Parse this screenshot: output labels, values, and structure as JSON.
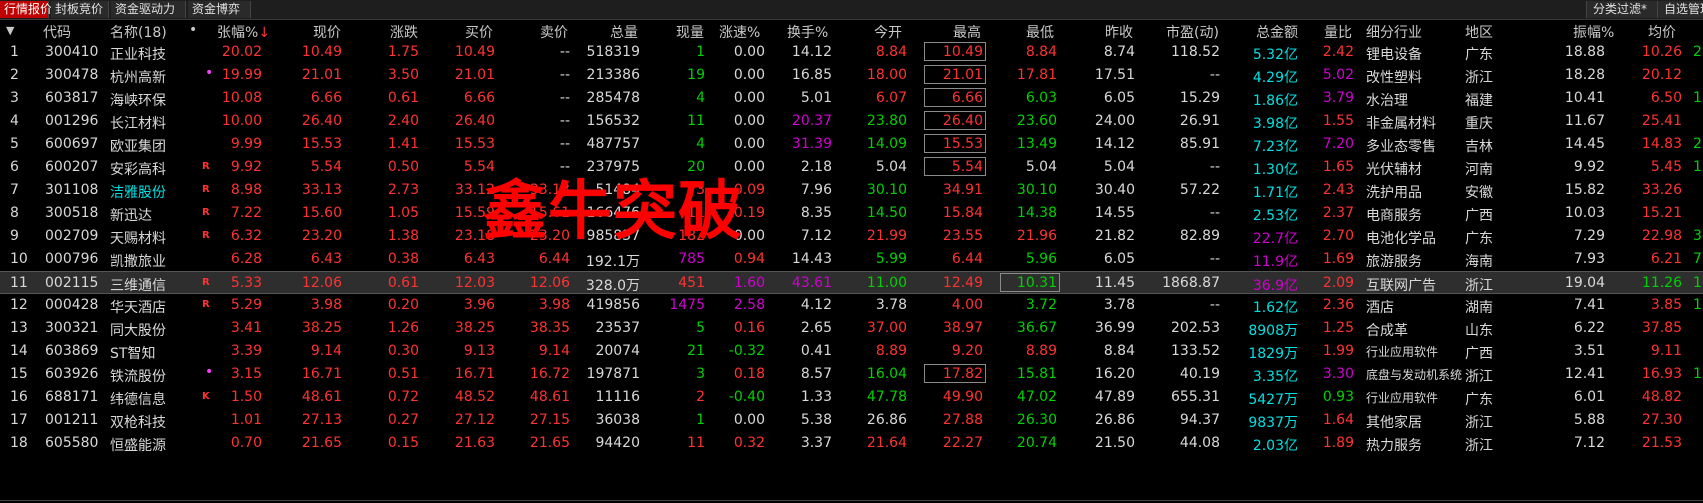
{
  "tabs": [
    "行情报价",
    "封板竞价",
    "资金驱动力",
    "资金博弈"
  ],
  "right_tabs": [
    "分类过滤*",
    "自选管理"
  ],
  "header": {
    "sort_icon": "▼",
    "code": "代码",
    "name": "名称(18)",
    "dot": "•",
    "change_pct": "张幅%",
    "sort_arrow": "↓",
    "price": "现价",
    "change": "涨跌",
    "bid": "买价",
    "ask": "卖价",
    "volume": "总量",
    "cur_vol": "现量",
    "speed": "涨速%",
    "turnover": "换手%",
    "open": "今开",
    "high": "最高",
    "low": "最低",
    "prev_close": "昨收",
    "pe": "市盈(动)",
    "amount": "总金额",
    "vol_ratio": "量比",
    "industry": "细分行业",
    "region": "地区",
    "amplitude": "振幅%",
    "avg": "均价"
  },
  "rows": [
    {
      "no": "1",
      "code": "300410",
      "name": "正业科技",
      "flag": "",
      "chg_pct": "20.02",
      "price": "10.49",
      "chg": "1.75",
      "bid": "10.49",
      "ask": "--",
      "vol": "518319",
      "cur_vol": "1",
      "speed": "0.00",
      "turnover": "14.12",
      "open": "8.84",
      "high": "10.49",
      "low": "8.84",
      "prev": "8.74",
      "pe": "118.52",
      "amount": "5.32亿",
      "vol_ratio": "2.42",
      "industry": "锂电设备",
      "region": "广东",
      "amp": "18.88",
      "avg": "10.26",
      "extra": "2"
    },
    {
      "no": "2",
      "code": "300478",
      "name": "杭州高新",
      "flag": "•",
      "chg_pct": "19.99",
      "price": "21.01",
      "chg": "3.50",
      "bid": "21.01",
      "ask": "--",
      "vol": "213386",
      "cur_vol": "19",
      "speed": "0.00",
      "turnover": "16.85",
      "open": "18.00",
      "high": "21.01",
      "low": "17.81",
      "prev": "17.51",
      "pe": "--",
      "amount": "4.29亿",
      "vol_ratio": "5.02",
      "industry": "改性塑料",
      "region": "浙江",
      "amp": "18.28",
      "avg": "20.12",
      "extra": ""
    },
    {
      "no": "3",
      "code": "603817",
      "name": "海峡环保",
      "flag": "",
      "chg_pct": "10.08",
      "price": "6.66",
      "chg": "0.61",
      "bid": "6.66",
      "ask": "--",
      "vol": "285478",
      "cur_vol": "4",
      "speed": "0.00",
      "turnover": "5.01",
      "open": "6.07",
      "high": "6.66",
      "low": "6.03",
      "prev": "6.05",
      "pe": "15.29",
      "amount": "1.86亿",
      "vol_ratio": "3.79",
      "industry": "水治理",
      "region": "福建",
      "amp": "10.41",
      "avg": "6.50",
      "extra": "1"
    },
    {
      "no": "4",
      "code": "001296",
      "name": "长江材料",
      "flag": "",
      "chg_pct": "10.00",
      "price": "26.40",
      "chg": "2.40",
      "bid": "26.40",
      "ask": "--",
      "vol": "156532",
      "cur_vol": "11",
      "speed": "0.00",
      "turnover": "20.37",
      "open": "23.80",
      "high": "26.40",
      "low": "23.60",
      "prev": "24.00",
      "pe": "26.91",
      "amount": "3.98亿",
      "vol_ratio": "1.55",
      "industry": "非金属材料",
      "region": "重庆",
      "amp": "11.67",
      "avg": "25.41",
      "extra": ""
    },
    {
      "no": "5",
      "code": "600697",
      "name": "欧亚集团",
      "flag": "",
      "chg_pct": "9.99",
      "price": "15.53",
      "chg": "1.41",
      "bid": "15.53",
      "ask": "--",
      "vol": "487757",
      "cur_vol": "4",
      "speed": "0.00",
      "turnover": "31.39",
      "open": "14.09",
      "high": "15.53",
      "low": "13.49",
      "prev": "14.12",
      "pe": "85.91",
      "amount": "7.23亿",
      "vol_ratio": "7.20",
      "industry": "多业态零售",
      "region": "吉林",
      "amp": "14.45",
      "avg": "14.83",
      "extra": "2"
    },
    {
      "no": "6",
      "code": "600207",
      "name": "安彩高科",
      "flag": "R",
      "chg_pct": "9.92",
      "price": "5.54",
      "chg": "0.50",
      "bid": "5.54",
      "ask": "--",
      "vol": "237975",
      "cur_vol": "20",
      "speed": "0.00",
      "turnover": "2.18",
      "open": "5.04",
      "high": "5.54",
      "low": "5.04",
      "prev": "5.04",
      "pe": "--",
      "amount": "1.30亿",
      "vol_ratio": "1.65",
      "industry": "光伏辅材",
      "region": "河南",
      "amp": "9.92",
      "avg": "5.45",
      "extra": "1"
    },
    {
      "no": "7",
      "code": "301108",
      "name": "洁雅股份",
      "flag": "R",
      "chg_pct": "8.98",
      "price": "33.13",
      "chg": "2.73",
      "bid": "33.12",
      "ask": "33.13",
      "vol": "51484",
      "cur_vol": "3",
      "speed": "0.09",
      "turnover": "7.96",
      "open": "30.10",
      "high": "34.91",
      "low": "30.10",
      "prev": "30.40",
      "pe": "57.22",
      "amount": "1.71亿",
      "vol_ratio": "2.43",
      "industry": "洗护用品",
      "region": "安徽",
      "amp": "15.82",
      "avg": "33.26",
      "extra": ""
    },
    {
      "no": "8",
      "code": "300518",
      "name": "新迅达",
      "flag": "R",
      "chg_pct": "7.22",
      "price": "15.60",
      "chg": "1.05",
      "bid": "15.59",
      "ask": "15.61",
      "vol": "166476",
      "cur_vol": "11",
      "speed": "0.19",
      "turnover": "8.35",
      "open": "14.50",
      "high": "15.84",
      "low": "14.38",
      "prev": "14.55",
      "pe": "--",
      "amount": "2.53亿",
      "vol_ratio": "2.37",
      "industry": "电商服务",
      "region": "广西",
      "amp": "10.03",
      "avg": "15.21",
      "extra": ""
    },
    {
      "no": "9",
      "code": "002709",
      "name": "天赐材料",
      "flag": "R",
      "chg_pct": "6.32",
      "price": "23.20",
      "chg": "1.38",
      "bid": "23.18",
      "ask": "23.20",
      "vol": "985837",
      "cur_vol": "182",
      "speed": "0.00",
      "turnover": "7.12",
      "open": "21.99",
      "high": "23.55",
      "low": "21.96",
      "prev": "21.82",
      "pe": "82.89",
      "amount": "22.7亿",
      "vol_ratio": "2.70",
      "industry": "电池化学品",
      "region": "广东",
      "amp": "7.29",
      "avg": "22.98",
      "extra": "3"
    },
    {
      "no": "10",
      "code": "000796",
      "name": "凯撒旅业",
      "flag": "",
      "chg_pct": "6.28",
      "price": "6.43",
      "chg": "0.38",
      "bid": "6.43",
      "ask": "6.44",
      "vol": "192.1万",
      "cur_vol": "785",
      "speed": "0.94",
      "turnover": "14.43",
      "open": "5.99",
      "high": "6.44",
      "low": "5.96",
      "prev": "6.05",
      "pe": "--",
      "amount": "11.9亿",
      "vol_ratio": "1.69",
      "industry": "旅游服务",
      "region": "海南",
      "amp": "7.93",
      "avg": "6.21",
      "extra": "7"
    },
    {
      "no": "11",
      "code": "002115",
      "name": "三维通信",
      "flag": "R",
      "chg_pct": "5.33",
      "price": "12.06",
      "chg": "0.61",
      "bid": "12.03",
      "ask": "12.06",
      "vol": "328.0万",
      "cur_vol": "451",
      "speed": "1.60",
      "turnover": "43.61",
      "open": "11.00",
      "high": "12.49",
      "low": "10.31",
      "prev": "11.45",
      "pe": "1868.87",
      "amount": "36.9亿",
      "vol_ratio": "2.09",
      "industry": "互联网广告",
      "region": "浙江",
      "amp": "19.04",
      "avg": "11.26",
      "extra": "1"
    },
    {
      "no": "12",
      "code": "000428",
      "name": "华天酒店",
      "flag": "R",
      "chg_pct": "5.29",
      "price": "3.98",
      "chg": "0.20",
      "bid": "3.96",
      "ask": "3.98",
      "vol": "419856",
      "cur_vol": "1475",
      "speed": "2.58",
      "turnover": "4.12",
      "open": "3.78",
      "high": "4.00",
      "low": "3.72",
      "prev": "3.78",
      "pe": "--",
      "amount": "1.62亿",
      "vol_ratio": "2.36",
      "industry": "酒店",
      "region": "湖南",
      "amp": "7.41",
      "avg": "3.85",
      "extra": "1"
    },
    {
      "no": "13",
      "code": "300321",
      "name": "同大股份",
      "flag": "",
      "chg_pct": "3.41",
      "price": "38.25",
      "chg": "1.26",
      "bid": "38.25",
      "ask": "38.35",
      "vol": "23537",
      "cur_vol": "5",
      "speed": "0.16",
      "turnover": "2.65",
      "open": "37.00",
      "high": "38.97",
      "low": "36.67",
      "prev": "36.99",
      "pe": "202.53",
      "amount": "8908万",
      "vol_ratio": "1.25",
      "industry": "合成革",
      "region": "山东",
      "amp": "6.22",
      "avg": "37.85",
      "extra": ""
    },
    {
      "no": "14",
      "code": "603869",
      "name": "ST智知",
      "flag": "",
      "chg_pct": "3.39",
      "price": "9.14",
      "chg": "0.30",
      "bid": "9.13",
      "ask": "9.14",
      "vol": "20074",
      "cur_vol": "21",
      "speed": "-0.32",
      "turnover": "0.41",
      "open": "8.89",
      "high": "9.20",
      "low": "8.89",
      "prev": "8.84",
      "pe": "133.52",
      "amount": "1829万",
      "vol_ratio": "1.99",
      "industry": "行业应用软件",
      "region": "广西",
      "amp": "3.51",
      "avg": "9.11",
      "extra": ""
    },
    {
      "no": "15",
      "code": "603926",
      "name": "铁流股份",
      "flag": "•",
      "chg_pct": "3.15",
      "price": "16.71",
      "chg": "0.51",
      "bid": "16.71",
      "ask": "16.72",
      "vol": "197871",
      "cur_vol": "3",
      "speed": "0.18",
      "turnover": "8.57",
      "open": "16.04",
      "high": "17.82",
      "low": "15.81",
      "prev": "16.20",
      "pe": "40.19",
      "amount": "3.35亿",
      "vol_ratio": "3.30",
      "industry": "底盘与发动机系统",
      "region": "浙江",
      "amp": "12.41",
      "avg": "16.93",
      "extra": "1"
    },
    {
      "no": "16",
      "code": "688171",
      "name": "纬德信息",
      "flag": "K",
      "chg_pct": "1.50",
      "price": "48.61",
      "chg": "0.72",
      "bid": "48.52",
      "ask": "48.61",
      "vol": "11116",
      "cur_vol": "2",
      "speed": "-0.40",
      "turnover": "1.33",
      "open": "47.78",
      "high": "49.90",
      "low": "47.02",
      "prev": "47.89",
      "pe": "655.31",
      "amount": "5427万",
      "vol_ratio": "0.93",
      "industry": "行业应用软件",
      "region": "广东",
      "amp": "6.01",
      "avg": "48.82",
      "extra": ""
    },
    {
      "no": "17",
      "code": "001211",
      "name": "双枪科技",
      "flag": "",
      "chg_pct": "1.01",
      "price": "27.13",
      "chg": "0.27",
      "bid": "27.12",
      "ask": "27.15",
      "vol": "36038",
      "cur_vol": "1",
      "speed": "0.00",
      "turnover": "5.38",
      "open": "26.86",
      "high": "27.88",
      "low": "26.30",
      "prev": "26.86",
      "pe": "94.37",
      "amount": "9837万",
      "vol_ratio": "1.64",
      "industry": "其他家居",
      "region": "浙江",
      "amp": "5.88",
      "avg": "27.30",
      "extra": ""
    },
    {
      "no": "18",
      "code": "605580",
      "name": "恒盛能源",
      "flag": "",
      "chg_pct": "0.70",
      "price": "21.65",
      "chg": "0.15",
      "bid": "21.63",
      "ask": "21.65",
      "vol": "94420",
      "cur_vol": "11",
      "speed": "0.32",
      "turnover": "3.37",
      "open": "21.64",
      "high": "22.27",
      "low": "20.74",
      "prev": "21.50",
      "pe": "44.08",
      "amount": "2.03亿",
      "vol_ratio": "1.89",
      "industry": "热力服务",
      "region": "浙江",
      "amp": "7.12",
      "avg": "21.53",
      "extra": ""
    }
  ],
  "watermark": "鑫牛突破",
  "colors": {
    "up": "#ff3232",
    "down": "#00d000",
    "flat": "#d8d8d8",
    "amount": "#00e0e0",
    "purple": "#d000d0",
    "yellow": "#f0f000"
  }
}
